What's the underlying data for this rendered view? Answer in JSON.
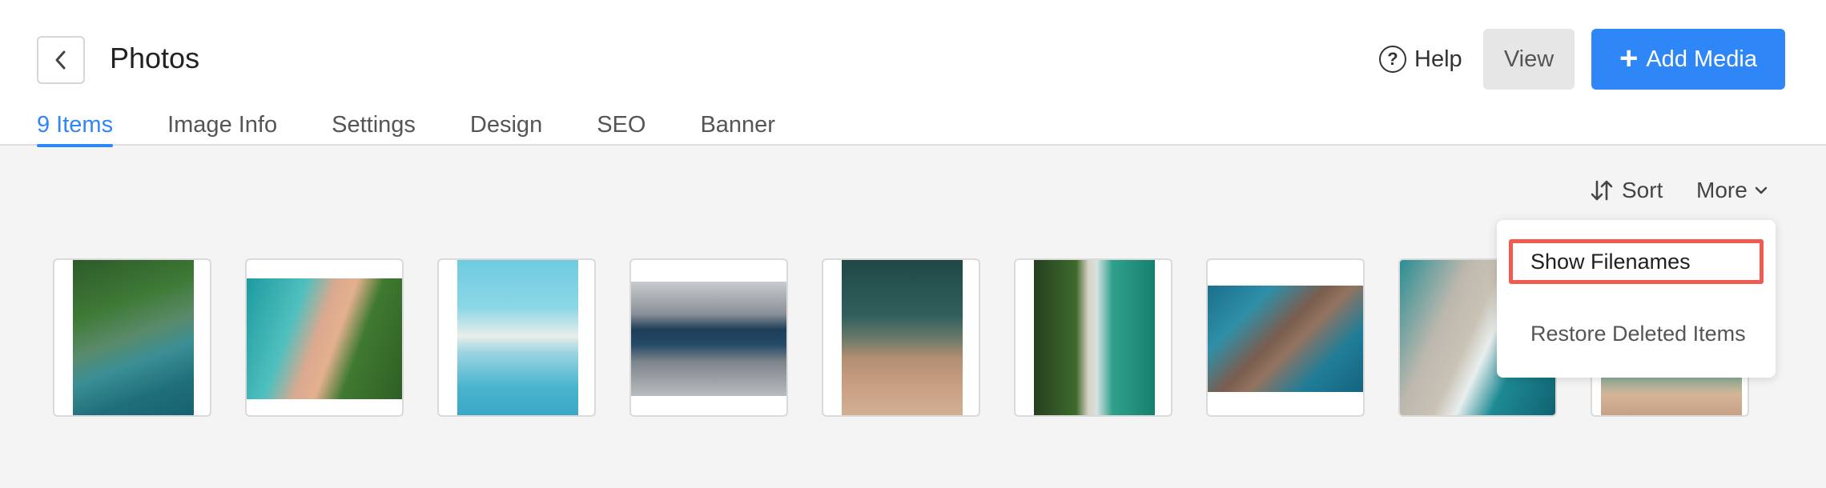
{
  "header": {
    "title": "Photos",
    "help_label": "Help",
    "view_label": "View",
    "add_media_label": "Add Media"
  },
  "tabs": [
    {
      "label": "9 Items",
      "active": true
    },
    {
      "label": "Image Info",
      "active": false
    },
    {
      "label": "Settings",
      "active": false
    },
    {
      "label": "Design",
      "active": false
    },
    {
      "label": "SEO",
      "active": false
    },
    {
      "label": "Banner",
      "active": false
    }
  ],
  "toolbar": {
    "sort_label": "Sort",
    "more_label": "More"
  },
  "more_menu": {
    "items": [
      {
        "label": "Show Filenames",
        "highlighted": true
      },
      {
        "label": "Restore Deleted Items",
        "highlighted": false
      }
    ]
  },
  "photos": [
    {
      "description": "aerial forest coast"
    },
    {
      "description": "aerial beach and green cliff"
    },
    {
      "description": "aerial turquoise sandbar"
    },
    {
      "description": "aerial city canal"
    },
    {
      "description": "aerial sand shoreline"
    },
    {
      "description": "aerial beach and forest strip"
    },
    {
      "description": "aerial rocks and waves"
    },
    {
      "description": "aerial sand and ocean"
    },
    {
      "description": "aerial green water beach"
    }
  ],
  "colors": {
    "accent": "#2f86f6",
    "highlight_border": "#ef5b50",
    "background": "#f4f4f4"
  }
}
